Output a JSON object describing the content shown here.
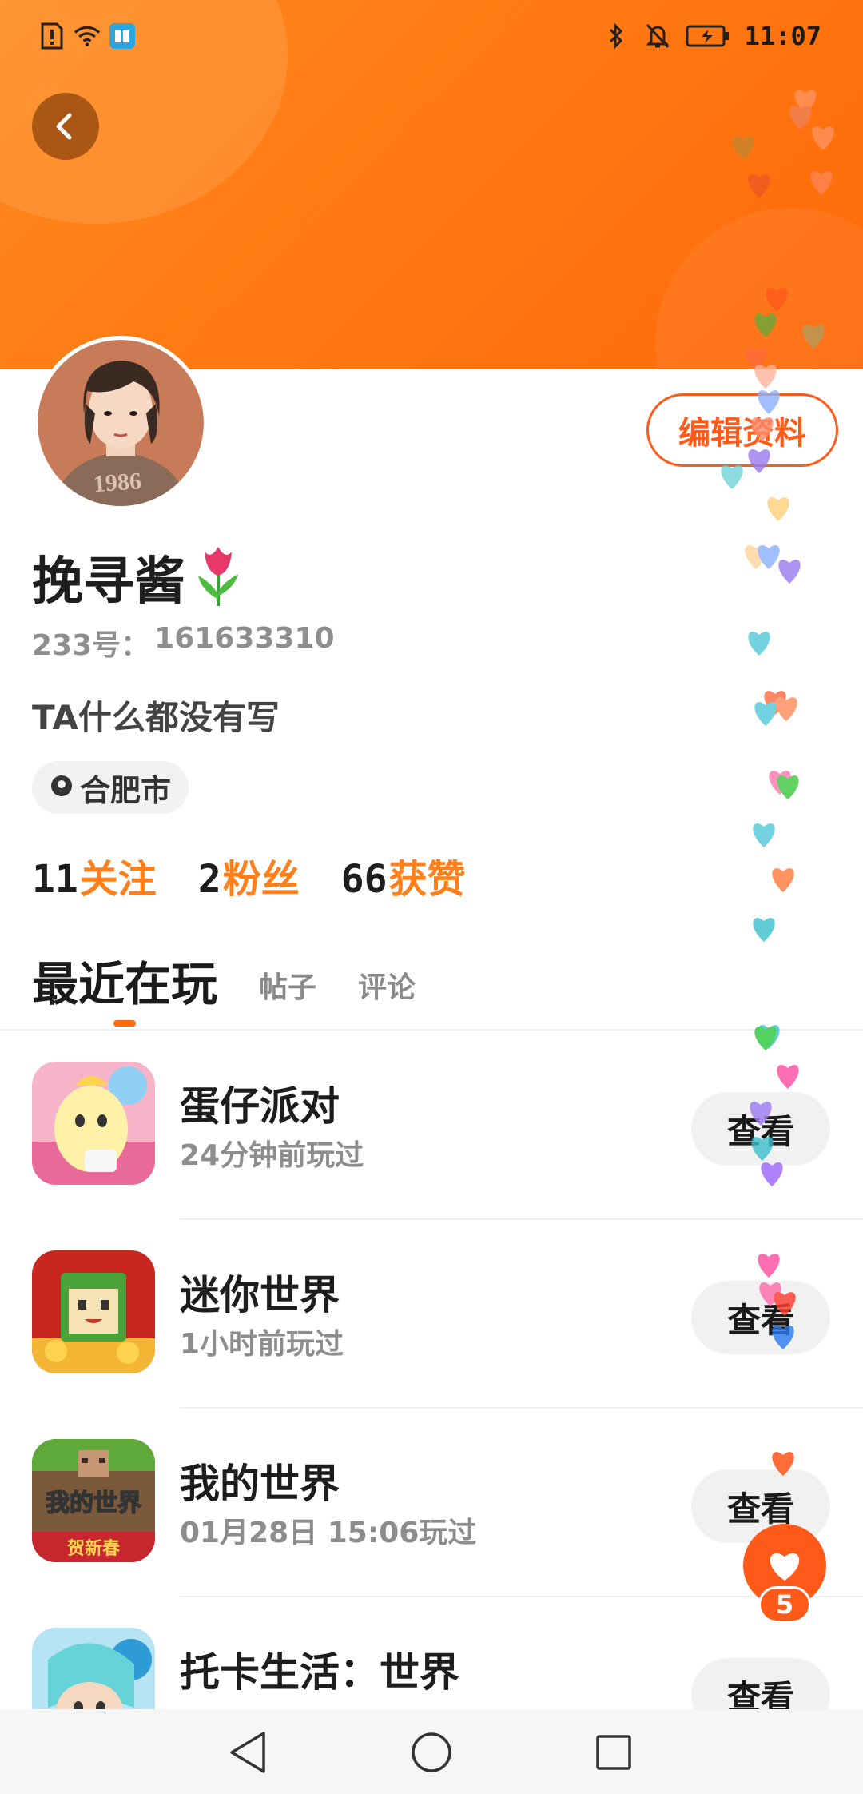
{
  "status_bar": {
    "time": "11:07"
  },
  "profile": {
    "name": "挽寻酱",
    "id_label": "233号：",
    "id_value": "161633310",
    "bio": "TA什么都没有写",
    "location": "合肥市",
    "edit_button": "编辑资料"
  },
  "stats": [
    {
      "count": "11",
      "label": "关注"
    },
    {
      "count": "2",
      "label": "粉丝"
    },
    {
      "count": "66",
      "label": "获赞"
    }
  ],
  "tabs": {
    "active": "最近在玩",
    "posts": "帖子",
    "comments": "评论"
  },
  "games": [
    {
      "title": "蛋仔派对",
      "subtitle": "24分钟前玩过",
      "button": "查看"
    },
    {
      "title": "迷你世界",
      "subtitle": "1小时前玩过",
      "button": "查看"
    },
    {
      "title": "我的世界",
      "subtitle": "01月28日 15:06玩过",
      "button": "查看"
    },
    {
      "title": "托卡生活：世界",
      "subtitle": "",
      "button": "查看"
    }
  ],
  "game_icon_texts": {
    "minecraft_logo": "我的世界",
    "minecraft_banner": "贺新春"
  },
  "like_fab": {
    "count": "5"
  },
  "colors": {
    "accent": "#ff6a0a",
    "header": "#ff7a12",
    "stat_label": "#ff7f1a"
  }
}
